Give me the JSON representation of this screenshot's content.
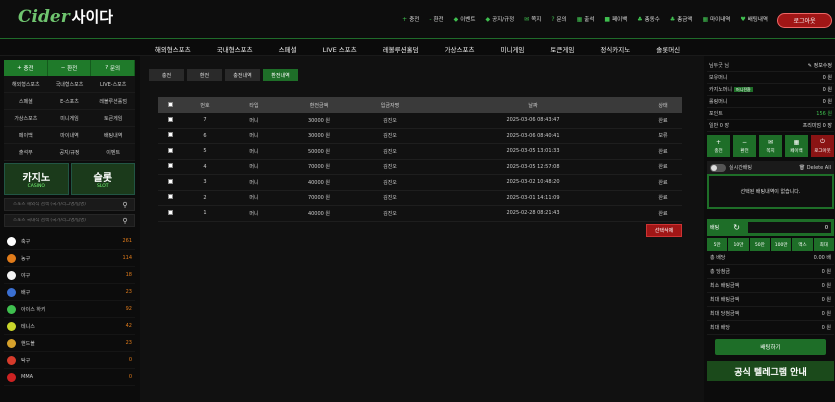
{
  "header": {
    "logo_mark": "Cider",
    "logo_name": "사이다",
    "nav": [
      {
        "icon": "+",
        "label": "충전"
      },
      {
        "icon": "-",
        "label": "환전"
      },
      {
        "icon": "◆",
        "label": "이벤트"
      },
      {
        "icon": "◆",
        "label": "공지/규정"
      },
      {
        "icon": "✉",
        "label": "쪽지"
      },
      {
        "icon": "?",
        "label": "문의"
      },
      {
        "icon": "▦",
        "label": "출석"
      },
      {
        "icon": "■",
        "label": "페이백"
      },
      {
        "icon": "♣",
        "label": "총동수"
      },
      {
        "icon": "♣",
        "label": "총금액"
      },
      {
        "icon": "▦",
        "label": "마이내역"
      },
      {
        "icon": "♥",
        "label": "배팅내역"
      }
    ],
    "logout_label": "로그아웃"
  },
  "mainnav": [
    "해외형스포츠",
    "국내형스포츠",
    "스페셜",
    "LIVE 스포츠",
    "레볼루션홀덤",
    "가상스포츠",
    "미니게임",
    "토큰게임",
    "정식카지노",
    "솔롯머신"
  ],
  "left": {
    "quick": [
      {
        "icon": "+",
        "label": "충전"
      },
      {
        "icon": "−",
        "label": "환전"
      },
      {
        "icon": "?",
        "label": "문의"
      }
    ],
    "menu": [
      "해외형스포츠",
      "국내형스포츠",
      "LIVE-스포츠",
      "스페셜",
      "E-스포츠",
      "레볼루션홀덤",
      "가상스포츠",
      "미니게임",
      "토큰게임",
      "페이백",
      "마이내역",
      "배팅내역",
      "출석부",
      "공지/규정",
      "이벤트"
    ],
    "banner_casino": {
      "title": "카지노",
      "sub": "CASINO"
    },
    "banner_slot": {
      "title": "슬롯",
      "sub": "SLOT"
    },
    "search1_placeholder": "스포츠 해외식 검색 (국가/리그명/팀명)",
    "search2_placeholder": "스포츠 국내식 검색 (국가/리그명/팀명)",
    "sports": [
      {
        "name": "축구",
        "count": "261",
        "color": "#ffffff"
      },
      {
        "name": "농구",
        "count": "114",
        "color": "#e07b1a"
      },
      {
        "name": "야구",
        "count": "18",
        "color": "#f2f2f2"
      },
      {
        "name": "배구",
        "count": "23",
        "color": "#3a6fd1"
      },
      {
        "name": "아이스 하키",
        "count": "92",
        "color": "#3fbf4f"
      },
      {
        "name": "테니스",
        "count": "42",
        "color": "#c9d62b"
      },
      {
        "name": "핸드볼",
        "count": "23",
        "color": "#d6a12b"
      },
      {
        "name": "탁구",
        "count": "0",
        "color": "#d63b2b"
      },
      {
        "name": "MMA",
        "count": "0",
        "color": "#c22"
      }
    ]
  },
  "center": {
    "tabs": [
      "충전",
      "환전",
      "충전내역",
      "환전내역"
    ],
    "active_tab": 3,
    "columns": [
      "",
      "번호",
      "타입",
      "환전금액",
      "입금자명",
      "날짜",
      "상태"
    ],
    "rows": [
      {
        "no": "7",
        "type": "머니",
        "amount": "30000 원",
        "name": "김진오",
        "date": "2025-03-06 08:43:47",
        "status": "완료"
      },
      {
        "no": "6",
        "type": "머니",
        "amount": "30000 원",
        "name": "김진오",
        "date": "2025-03-06 08:40:41",
        "status": "보류"
      },
      {
        "no": "5",
        "type": "머니",
        "amount": "50000 원",
        "name": "김진오",
        "date": "2025-03-05 13:01:33",
        "status": "완료"
      },
      {
        "no": "4",
        "type": "머니",
        "amount": "70000 원",
        "name": "김진오",
        "date": "2025-03-05 12:57:08",
        "status": "완료"
      },
      {
        "no": "3",
        "type": "머니",
        "amount": "40000 원",
        "name": "김진오",
        "date": "2025-03-02 10:48:20",
        "status": "완료"
      },
      {
        "no": "2",
        "type": "머니",
        "amount": "70000 원",
        "name": "김진오",
        "date": "2025-03-01 14:11:09",
        "status": "완료"
      },
      {
        "no": "1",
        "type": "머니",
        "amount": "40000 원",
        "name": "김진오",
        "date": "2025-02-28 08:21:43",
        "status": "완료"
      }
    ],
    "delete_label": "선택삭제"
  },
  "right": {
    "user": "님두긋 님",
    "profile_label": "정보수정",
    "balances": [
      {
        "label": "보유머니",
        "value": "0 원"
      },
      {
        "label": "카지노머니",
        "value": "0 원",
        "pill": "머니전환"
      },
      {
        "label": "롤링머니",
        "value": "0 원"
      },
      {
        "label": "포인트",
        "value": "156 원"
      },
      {
        "label": "일반 0 장",
        "value": "프리미엄 0 장"
      }
    ],
    "btns": [
      {
        "icon": "+",
        "label": "충전"
      },
      {
        "icon": "−",
        "label": "환전"
      },
      {
        "icon": "✉",
        "label": "쪽지"
      },
      {
        "icon": "▦",
        "label": "페이백"
      },
      {
        "icon": "⏻",
        "label": "로그아웃"
      }
    ],
    "realtime_label": "실시간배팅",
    "delete_all_label": "Delete All",
    "empty_msg": "선택된 배팅내역이 없습니다.",
    "bet_label": "배팅",
    "bet_value": "0",
    "amounts": [
      "5만",
      "10만",
      "50만",
      "100만",
      "맥스",
      "최대"
    ],
    "kv": [
      {
        "label": "총 배당",
        "value": "0.00 배"
      },
      {
        "label": "총 당첨금",
        "value": "0 원"
      },
      {
        "label": "최소 배팅금액",
        "value": "0 원"
      },
      {
        "label": "최대 배팅금액",
        "value": "0 원"
      },
      {
        "label": "최대 당첨금액",
        "value": "0 원"
      },
      {
        "label": "최대 배당",
        "value": "0 원"
      }
    ],
    "bet_button": "배팅하기",
    "telegram": "공식 텔레그램 안내"
  }
}
